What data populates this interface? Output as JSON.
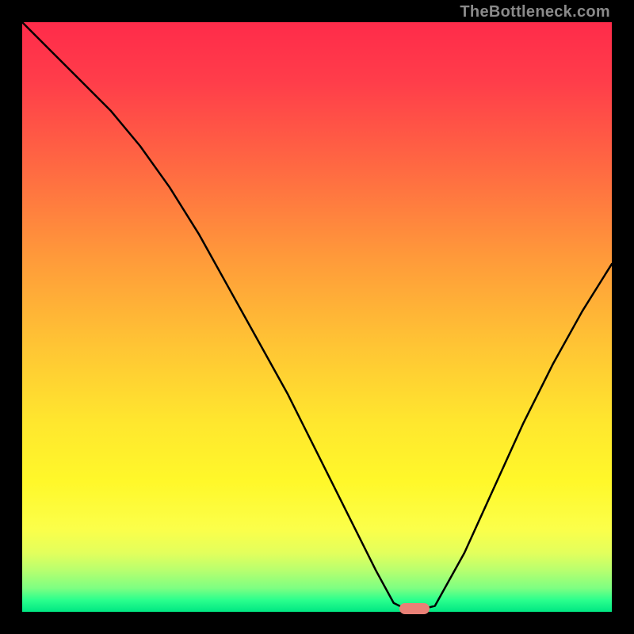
{
  "watermark": "TheBottleneck.com",
  "colors": {
    "background": "#000000",
    "curve": "#000000",
    "marker": "#e98076",
    "gradient_top": "#ff2b4a",
    "gradient_bottom": "#00e783"
  },
  "chart_data": {
    "type": "line",
    "title": "",
    "xlabel": "",
    "ylabel": "",
    "xlim": [
      0,
      100
    ],
    "ylim": [
      0,
      100
    ],
    "series": [
      {
        "name": "bottleneck-curve",
        "x": [
          0,
          5,
          10,
          15,
          20,
          25,
          30,
          35,
          40,
          45,
          50,
          55,
          60,
          63,
          65,
          68,
          70,
          75,
          80,
          85,
          90,
          95,
          100
        ],
        "values": [
          100,
          95,
          90,
          85,
          79,
          72,
          64,
          55,
          46,
          37,
          27,
          17,
          7,
          1.5,
          0.5,
          0.5,
          1,
          10,
          21,
          32,
          42,
          51,
          59
        ]
      }
    ],
    "marker": {
      "x": 66.5,
      "y": 0.5
    },
    "annotations": []
  }
}
